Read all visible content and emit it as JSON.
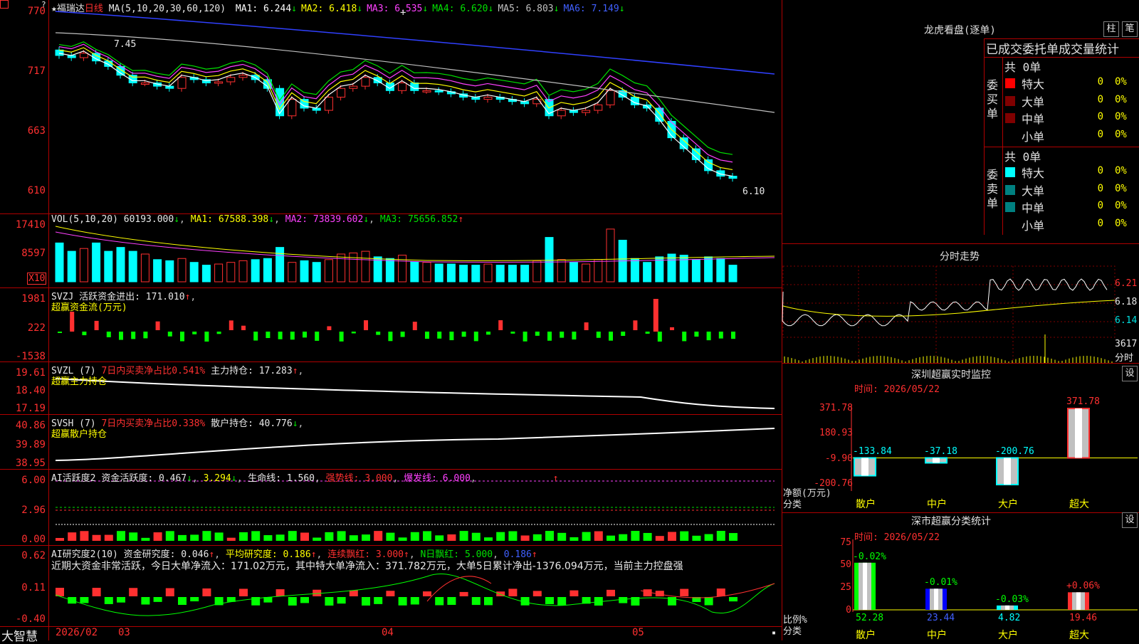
{
  "stock": {
    "name": "福瑞达",
    "period": "日线",
    "ma_title": "MA(5,10,20,30,60,120)",
    "ma": [
      {
        "label": "MA1:",
        "value": "6.244",
        "arrow": "↓",
        "color": "#ffffff"
      },
      {
        "label": "MA2:",
        "value": "6.418",
        "arrow": "↓",
        "color": "#ffff00"
      },
      {
        "label": "MA3:",
        "value": "6.535",
        "arrow": "↓",
        "color": "#ff40ff"
      },
      {
        "label": "MA4:",
        "value": "6.620",
        "arrow": "↓",
        "color": "#00e000"
      },
      {
        "label": "MA5:",
        "value": "6.803",
        "arrow": "↓",
        "color": "#c0c0c0"
      },
      {
        "label": "MA6:",
        "value": "7.149",
        "arrow": "↓",
        "color": "#4060ff"
      }
    ]
  },
  "price_axis": [
    "770",
    "717",
    "663",
    "610"
  ],
  "price_marks": {
    "high": "7.45",
    "low": "6.10"
  },
  "vol": {
    "title": "VOL(5,10,20)",
    "value": "60193.000",
    "ma1": "MA1: 67588.398",
    "ma2": "MA2: 73839.602",
    "ma3": "MA3: 75656.852",
    "axis": [
      "17410",
      "8597"
    ],
    "unit": "X10"
  },
  "svzj": {
    "title": "SVZJ",
    "line": "活跃资金进出: 171.010",
    "sub": "超赢资金流(万元)",
    "axis": [
      "1981",
      "222",
      "-1538"
    ]
  },
  "svzl": {
    "title": "SVZL (7)",
    "desc": "7日内买卖净占比0.541%",
    "main": "主力持仓: 17.283",
    "sub": "超赢主力持仓",
    "axis": [
      "19.61",
      "18.40",
      "17.19"
    ]
  },
  "svsh": {
    "title": "SVSH (7)",
    "desc": "7日内买卖净占比0.338%",
    "main": "散户持仓: 40.776",
    "sub": "超赢散户持仓",
    "axis": [
      "40.86",
      "39.89",
      "38.95"
    ]
  },
  "ai1": {
    "title": "AI活跃度2",
    "a": "资金活跃度: 0.467",
    "b": "3.294",
    "c": "生命线: 1.560",
    "d": "强势线: 3.000",
    "e": "爆发线: 6.000",
    "axis": [
      "6.00",
      "2.96",
      "0.00"
    ]
  },
  "ai2": {
    "title": "AI研究度2(10)",
    "a": "资金研究度: 0.046",
    "b": "平均研究度: 0.186",
    "c": "连续飘红: 3.000",
    "d": "N日飘红: 5.000",
    "e": "0.186",
    "note": "近期大资金非常活跃，今日大单净流入：171.02万元，其中特大单净流入：371.782万元，大单5日累计净出-1376.094万元，当前主力控盘强",
    "axis": [
      "0.62",
      "0.11",
      "-0.40"
    ]
  },
  "xaxis": [
    "2026/02",
    "03",
    "04",
    "05"
  ],
  "brand": "大智慧",
  "lhb": {
    "title": "龙虎看盘(逐单)",
    "btn1": "柱",
    "btn2": "笔",
    "sub": "已成交委托单成交量统计",
    "buy": {
      "side": "委买单",
      "total": "共 0单",
      "rows": [
        {
          "k": "特大",
          "v": "0",
          "p": "0%",
          "c": "#ff0000"
        },
        {
          "k": "大单",
          "v": "0",
          "p": "0%",
          "c": "#800000"
        },
        {
          "k": "中单",
          "v": "0",
          "p": "0%",
          "c": "#800000"
        },
        {
          "k": "小单",
          "v": "0",
          "p": "0%",
          "c": ""
        }
      ]
    },
    "sell": {
      "side": "委卖单",
      "total": "共 0单",
      "rows": [
        {
          "k": "特大",
          "v": "0",
          "p": "0%",
          "c": "#00ffff"
        },
        {
          "k": "大单",
          "v": "0",
          "p": "0%",
          "c": "#008080"
        },
        {
          "k": "中单",
          "v": "0",
          "p": "0%",
          "c": "#008080"
        },
        {
          "k": "小单",
          "v": "0",
          "p": "0%",
          "c": ""
        }
      ]
    }
  },
  "fs": {
    "title": "分时走势",
    "axis": [
      "6.21",
      "6.18",
      "6.14"
    ],
    "vol_label": "3617",
    "vol_unit": "分时"
  },
  "sz_monitor": {
    "title": "深圳超赢实时监控",
    "btn": "设",
    "time": "时间: 2026/05/22",
    "axis": [
      "371.78",
      "180.93",
      "-9.90",
      "-200.76"
    ],
    "ylabel1": "净额(万元)",
    "ylabel2": "分类",
    "bars": [
      {
        "cat": "散户",
        "val": "-133.84"
      },
      {
        "cat": "中户",
        "val": "-37.18"
      },
      {
        "cat": "大户",
        "val": "-200.76"
      },
      {
        "cat": "超大",
        "val": "371.78"
      }
    ]
  },
  "sz_class": {
    "title": "深市超赢分类统计",
    "btn": "设",
    "time": "时间: 2026/05/22",
    "axis": [
      "75",
      "50",
      "25",
      "0"
    ],
    "ylabel1": "比例%",
    "ylabel2": "分类",
    "bars": [
      {
        "cat": "散户",
        "val": "52.28",
        "chg": "-0.02%"
      },
      {
        "cat": "中户",
        "val": "23.44",
        "chg": "-0.01%"
      },
      {
        "cat": "大户",
        "val": "4.82",
        "chg": "-0.03%"
      },
      {
        "cat": "超大",
        "val": "19.46",
        "chg": "+0.06%"
      }
    ]
  }
}
